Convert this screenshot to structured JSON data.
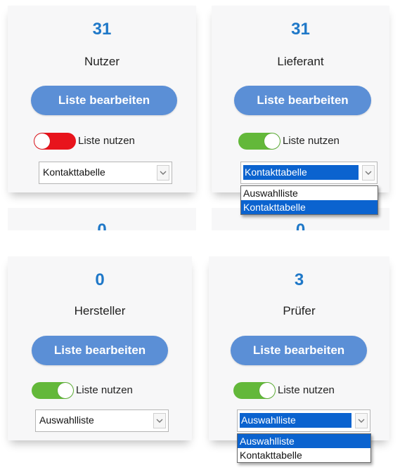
{
  "cards": [
    {
      "count": "31",
      "title": "Nutzer",
      "edit_label": "Liste bearbeiten",
      "toggle_label": "Liste nutzen",
      "toggle_state": "off",
      "select_value": "Kontakttabelle"
    },
    {
      "count": "31",
      "title": "Lieferant",
      "edit_label": "Liste bearbeiten",
      "toggle_label": "Liste nutzen",
      "toggle_state": "on",
      "select_value": "Kontakttabelle",
      "dropdown_options": [
        "Auswahlliste",
        "Kontakttabelle"
      ],
      "dropdown_selected": "Kontakttabelle"
    },
    {
      "count": "0",
      "title": "Hersteller",
      "edit_label": "Liste bearbeiten",
      "toggle_label": "Liste nutzen",
      "toggle_state": "on",
      "select_value": "Auswahlliste"
    },
    {
      "count": "3",
      "title": "Prüfer",
      "edit_label": "Liste bearbeiten",
      "toggle_label": "Liste nutzen",
      "toggle_state": "on",
      "select_value": "Auswahlliste",
      "dropdown_options": [
        "Auswahlliste",
        "Kontakttabelle"
      ],
      "dropdown_selected": "Auswahlliste"
    }
  ],
  "partial_counts": [
    "0",
    "0"
  ],
  "colors": {
    "accent": "#1f78c8",
    "button": "#5b8fd6",
    "toggle_on": "#63b83a",
    "toggle_off": "#e8141c",
    "highlight": "#0b63cf"
  }
}
